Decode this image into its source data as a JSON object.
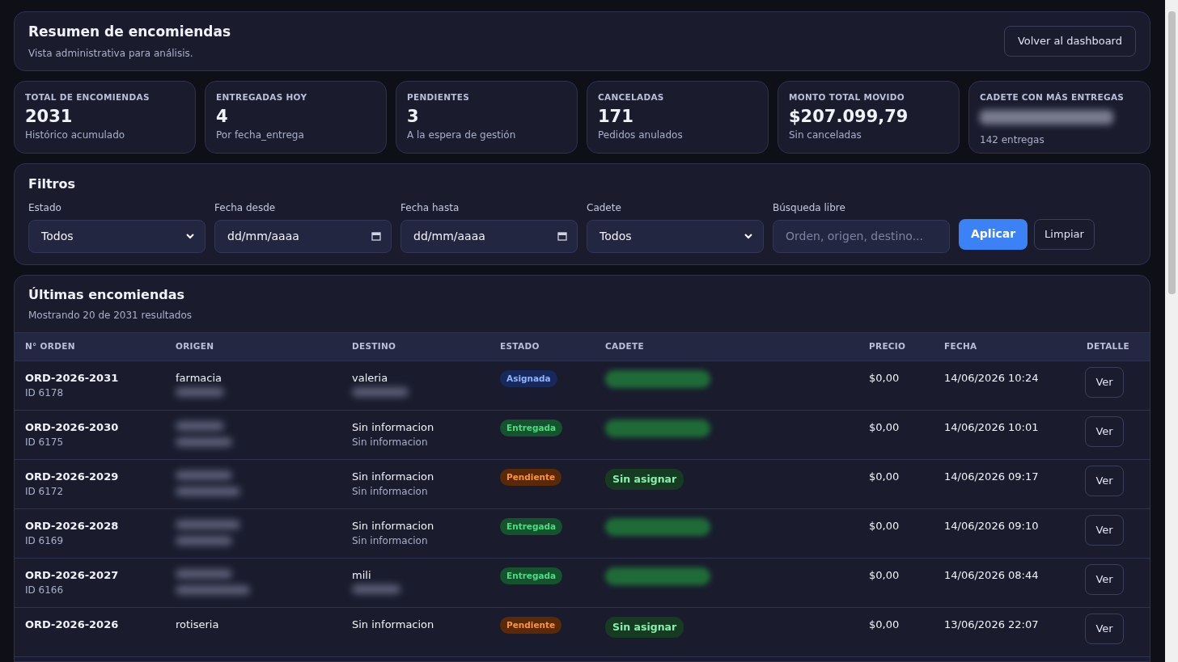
{
  "header": {
    "title": "Resumen de encomiendas",
    "subtitle": "Vista administrativa para análisis.",
    "back_button": "Volver al dashboard"
  },
  "stats": [
    {
      "label": "TOTAL DE ENCOMIENDAS",
      "value": "2031",
      "note": "Histórico acumulado"
    },
    {
      "label": "ENTREGADAS HOY",
      "value": "4",
      "note": "Por fecha_entrega"
    },
    {
      "label": "PENDIENTES",
      "value": "3",
      "note": "A la espera de gestión"
    },
    {
      "label": "CANCELADAS",
      "value": "171",
      "note": "Pedidos anulados"
    },
    {
      "label": "MONTO TOTAL MOVIDO",
      "value": "$207.099,79",
      "note": "Sin canceladas"
    },
    {
      "label": "CADETE CON MÁS ENTREGAS",
      "value_redacted": true,
      "note": "142 entregas"
    }
  ],
  "filters": {
    "title": "Filtros",
    "fields": [
      {
        "kind": "select",
        "label": "Estado",
        "value": "Todos"
      },
      {
        "kind": "date",
        "label": "Fecha desde",
        "value": "dd/mm/aaaa"
      },
      {
        "kind": "date",
        "label": "Fecha hasta",
        "value": "dd/mm/aaaa"
      },
      {
        "kind": "select",
        "label": "Cadete",
        "value": "Todos"
      },
      {
        "kind": "text",
        "label": "Búsqueda libre",
        "placeholder": "Orden, origen, destino..."
      }
    ],
    "apply_button": "Aplicar",
    "clear_button": "Limpiar"
  },
  "table": {
    "title": "Últimas encomiendas",
    "subtitle": "Mostrando 20 de 2031 resultados",
    "columns": [
      "N° ORDEN",
      "ORIGEN",
      "DESTINO",
      "ESTADO",
      "CADETE",
      "PRECIO",
      "FECHA",
      "DETALLE"
    ],
    "rows": [
      {
        "order": "ORD-2026-2031",
        "id": "ID 6178",
        "origin": [
          {
            "text": "farmacia"
          },
          {
            "redacted": true
          }
        ],
        "destination": [
          {
            "text": "valeria"
          },
          {
            "redacted": true
          }
        ],
        "status": {
          "kind": "assigned",
          "text": "Asignada"
        },
        "courier": {
          "redacted": true
        },
        "price": "$0,00",
        "date": "14/06/2026 10:24",
        "action": "Ver"
      },
      {
        "order": "ORD-2026-2030",
        "id": "ID 6175",
        "origin": [
          {
            "redacted": true
          },
          {
            "redacted": true
          }
        ],
        "destination": [
          {
            "text": "Sin informacion"
          },
          {
            "text": "Sin informacion"
          }
        ],
        "status": {
          "kind": "delivered",
          "text": "Entregada"
        },
        "courier": {
          "redacted": true
        },
        "price": "$0,00",
        "date": "14/06/2026 10:01",
        "action": "Ver"
      },
      {
        "order": "ORD-2026-2029",
        "id": "ID 6172",
        "origin": [
          {
            "redacted": true
          },
          {
            "redacted": true
          }
        ],
        "destination": [
          {
            "text": "Sin informacion"
          },
          {
            "text": "Sin informacion"
          }
        ],
        "status": {
          "kind": "pending",
          "text": "Pendiente"
        },
        "courier": {
          "text": "Sin asignar"
        },
        "price": "$0,00",
        "date": "14/06/2026 09:17",
        "action": "Ver"
      },
      {
        "order": "ORD-2026-2028",
        "id": "ID 6169",
        "origin": [
          {
            "redacted": true
          },
          {
            "redacted": true
          }
        ],
        "destination": [
          {
            "text": "Sin informacion"
          },
          {
            "text": "Sin informacion"
          }
        ],
        "status": {
          "kind": "delivered",
          "text": "Entregada"
        },
        "courier": {
          "redacted": true
        },
        "price": "$0,00",
        "date": "14/06/2026 09:10",
        "action": "Ver"
      },
      {
        "order": "ORD-2026-2027",
        "id": "ID 6166",
        "origin": [
          {
            "redacted": true
          },
          {
            "redacted": true
          }
        ],
        "destination": [
          {
            "text": "mili"
          },
          {
            "redacted": true
          }
        ],
        "status": {
          "kind": "delivered",
          "text": "Entregada"
        },
        "courier": {
          "redacted": true
        },
        "price": "$0,00",
        "date": "14/06/2026 08:44",
        "action": "Ver"
      },
      {
        "order": "ORD-2026-2026",
        "origin": [
          {
            "text": "rotiseria"
          }
        ],
        "destination": [
          {
            "text": "Sin informacion"
          }
        ],
        "status": {
          "kind": "pending",
          "text": "Pendiente"
        },
        "courier": {
          "text": "Sin asignar"
        },
        "price": "$0,00",
        "date": "13/06/2026 22:07",
        "action": "Ver"
      }
    ]
  }
}
